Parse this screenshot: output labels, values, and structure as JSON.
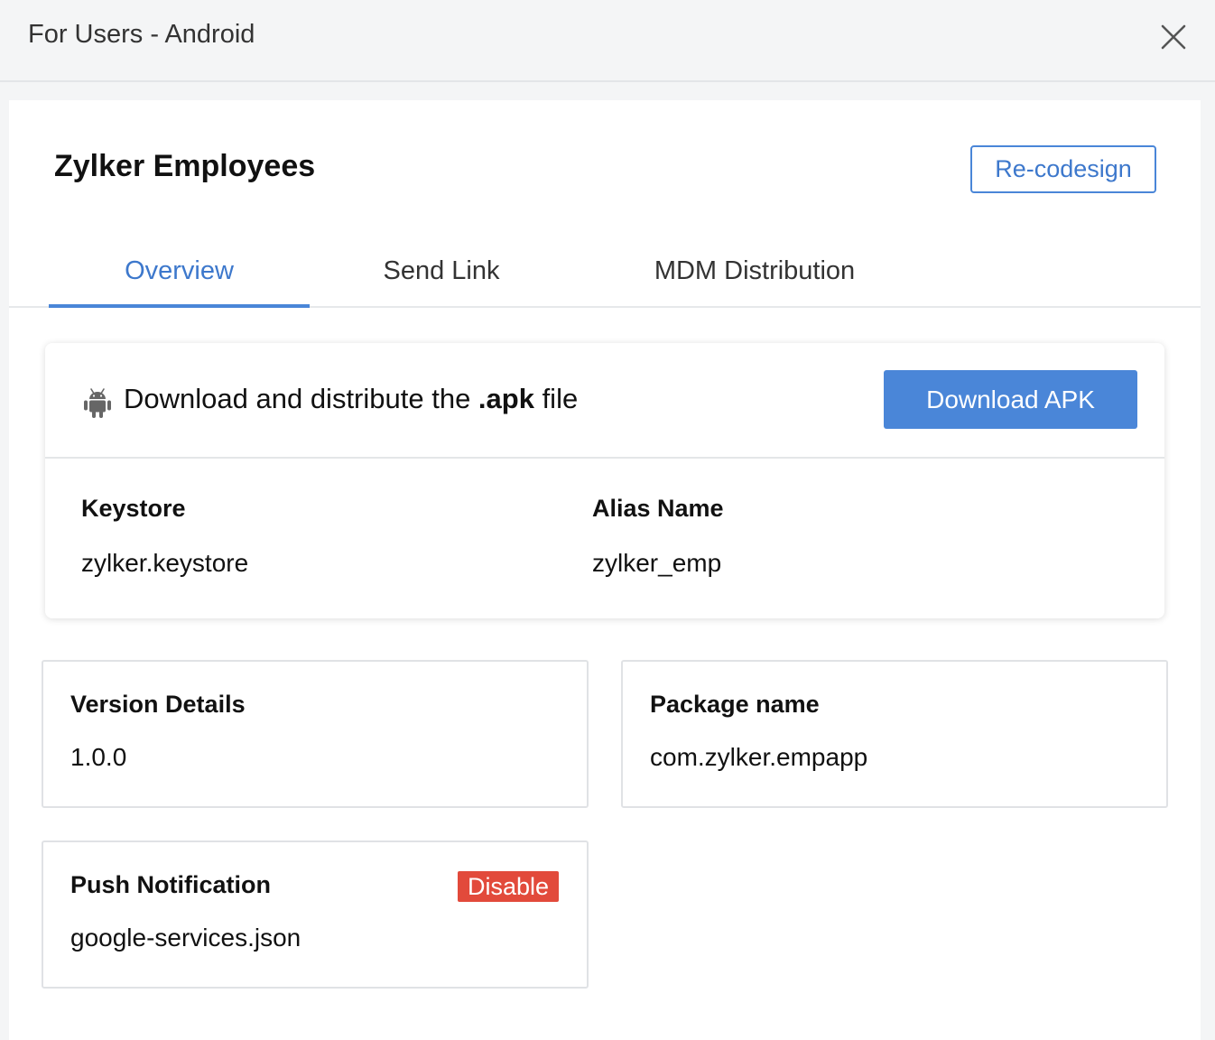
{
  "header": {
    "title": "For Users - Android",
    "close_icon": "close-icon"
  },
  "app": {
    "name": "Zylker Employees",
    "recodesign_label": "Re-codesign"
  },
  "tabs": [
    {
      "label": "Overview",
      "active": true
    },
    {
      "label": "Send Link",
      "active": false
    },
    {
      "label": "MDM Distribution",
      "active": false
    }
  ],
  "apk_section": {
    "icon": "android-icon",
    "text_prefix": "Download and distribute the ",
    "text_bold": ".apk",
    "text_suffix": " file",
    "download_label": "Download APK",
    "keystore_label": "Keystore",
    "keystore_value": "zylker.keystore",
    "alias_label": "Alias Name",
    "alias_value": "zylker_emp"
  },
  "version": {
    "label": "Version Details",
    "value": "1.0.0"
  },
  "package": {
    "label": "Package name",
    "value": "com.zylker.empapp"
  },
  "push": {
    "label": "Push Notification",
    "value": "google-services.json",
    "disable_label": "Disable"
  },
  "colors": {
    "accent": "#4a86d8",
    "danger": "#e24a3b",
    "background": "#f4f5f6"
  }
}
